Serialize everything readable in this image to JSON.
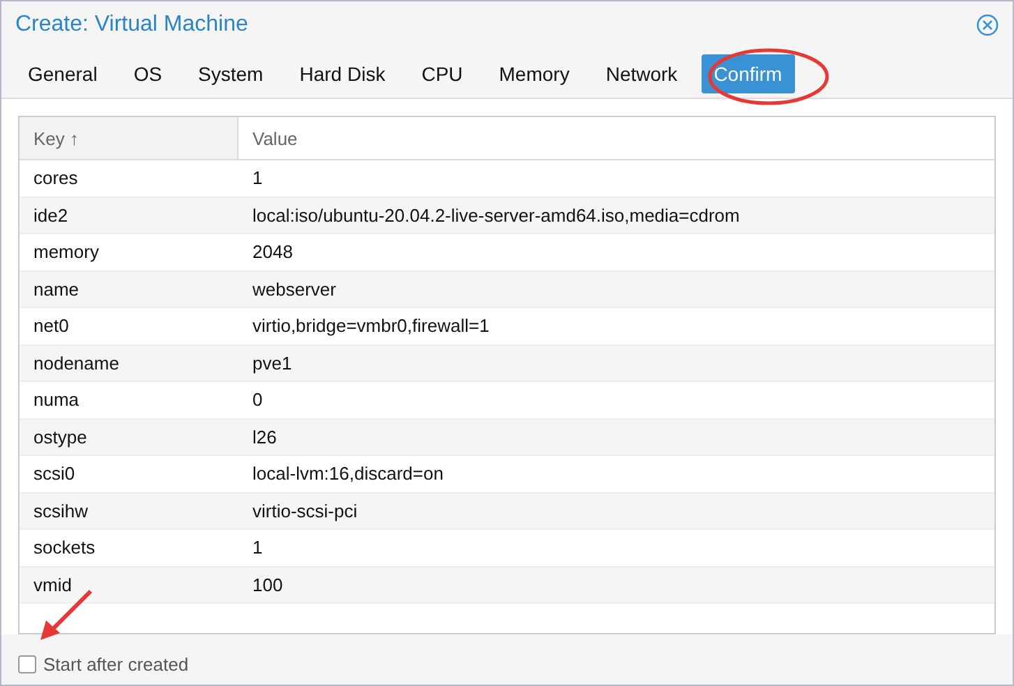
{
  "window": {
    "title": "Create: Virtual Machine"
  },
  "tabs": [
    {
      "label": "General",
      "selected": false
    },
    {
      "label": "OS",
      "selected": false
    },
    {
      "label": "System",
      "selected": false
    },
    {
      "label": "Hard Disk",
      "selected": false
    },
    {
      "label": "CPU",
      "selected": false
    },
    {
      "label": "Memory",
      "selected": false
    },
    {
      "label": "Network",
      "selected": false
    },
    {
      "label": "Confirm",
      "selected": true
    }
  ],
  "table": {
    "columns": [
      "Key ↑",
      "Value"
    ],
    "rows": [
      [
        "cores",
        "1"
      ],
      [
        "ide2",
        "local:iso/ubuntu-20.04.2-live-server-amd64.iso,media=cdrom"
      ],
      [
        "memory",
        "2048"
      ],
      [
        "name",
        "webserver"
      ],
      [
        "net0",
        "virtio,bridge=vmbr0,firewall=1"
      ],
      [
        "nodename",
        "pve1"
      ],
      [
        "numa",
        "0"
      ],
      [
        "ostype",
        "l26"
      ],
      [
        "scsi0",
        "local-lvm:16,discard=on"
      ],
      [
        "scsihw",
        "virtio-scsi-pci"
      ],
      [
        "sockets",
        "1"
      ],
      [
        "vmid",
        "100"
      ]
    ]
  },
  "start_after_created": {
    "label": "Start after created",
    "checked": false
  }
}
